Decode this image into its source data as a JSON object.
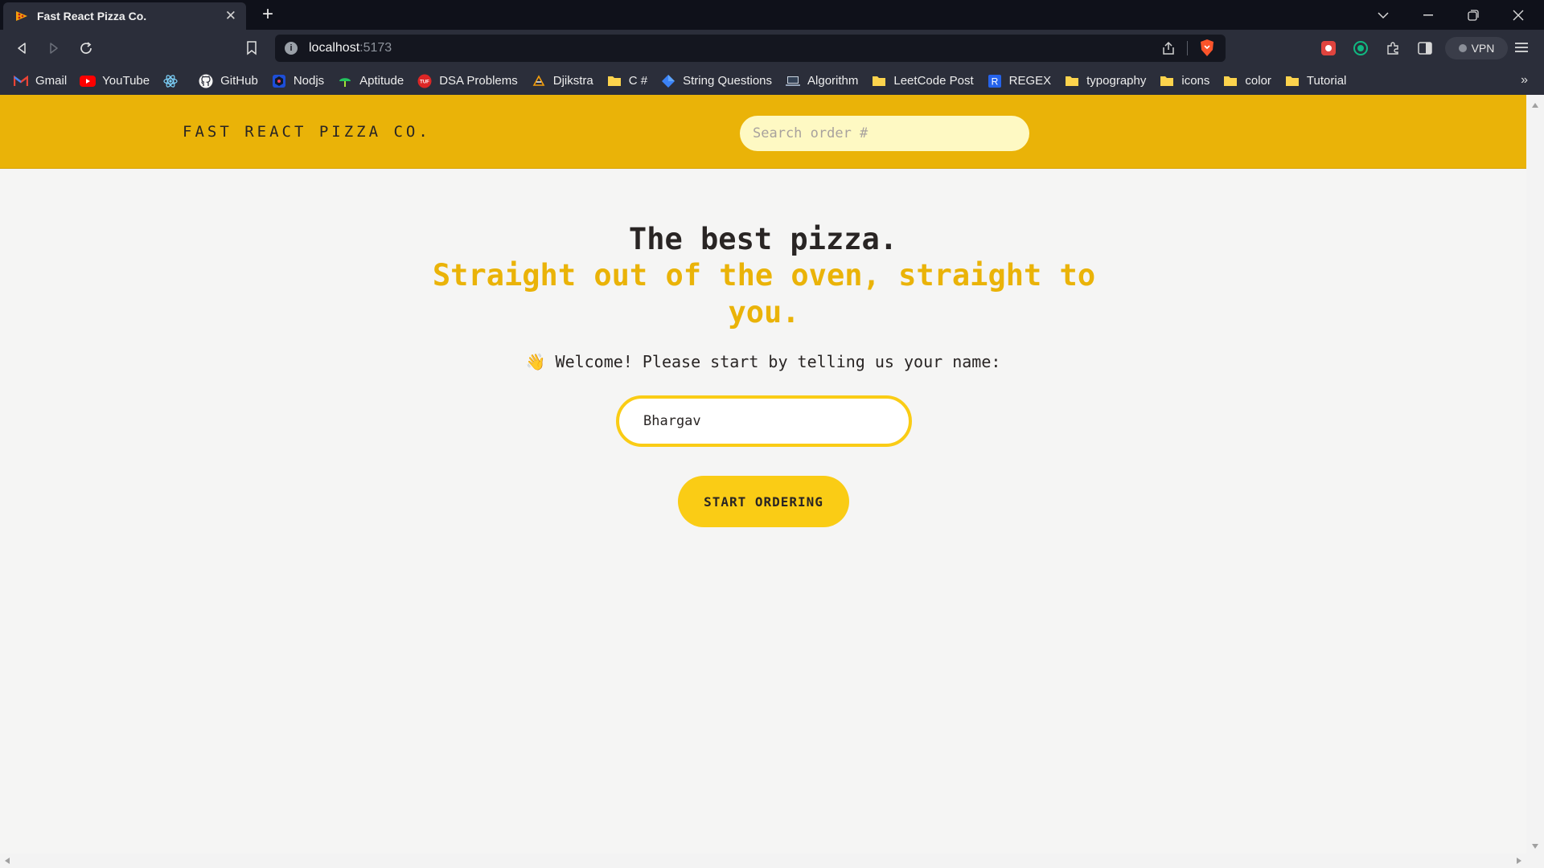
{
  "browser": {
    "tab_title": "Fast React Pizza Co.",
    "url_host": "localhost",
    "url_port": ":5173",
    "vpn_label": "VPN",
    "bookmarks": [
      {
        "label": "Gmail",
        "icon": "gmail-icon"
      },
      {
        "label": "YouTube",
        "icon": "youtube-icon"
      },
      {
        "label": "",
        "icon": "react-icon"
      },
      {
        "label": "GitHub",
        "icon": "github-icon"
      },
      {
        "label": "Nodjs",
        "icon": "nodejs-icon"
      },
      {
        "label": "Aptitude",
        "icon": "aptitude-icon"
      },
      {
        "label": "DSA Problems",
        "icon": "tuf-icon"
      },
      {
        "label": "Djikstra",
        "icon": "djikstra-icon"
      },
      {
        "label": "C #",
        "icon": "folder-icon"
      },
      {
        "label": "String Questions",
        "icon": "diamond-icon"
      },
      {
        "label": "Algorithm",
        "icon": "laptop-icon"
      },
      {
        "label": "LeetCode Post",
        "icon": "folder-icon"
      },
      {
        "label": "REGEX",
        "icon": "regex-icon"
      },
      {
        "label": "typography",
        "icon": "folder-icon"
      },
      {
        "label": "icons",
        "icon": "folder-icon"
      },
      {
        "label": "color",
        "icon": "folder-icon"
      },
      {
        "label": "Tutorial",
        "icon": "folder-icon"
      }
    ],
    "more_label": "»"
  },
  "app": {
    "logo": "FAST REACT PIZZA CO.",
    "search_placeholder": "Search order #",
    "headline": "The best pizza.",
    "subheadline": "Straight out of the oven, straight to you.",
    "welcome": "👋 Welcome! Please start by telling us your name:",
    "name_value": "Bhargav",
    "start_button": "START ORDERING"
  },
  "colors": {
    "header_bg": "#eab308",
    "accent": "#facc15",
    "search_bg": "#fef9c3",
    "page_bg": "#f5f5f4",
    "text": "#292524"
  }
}
